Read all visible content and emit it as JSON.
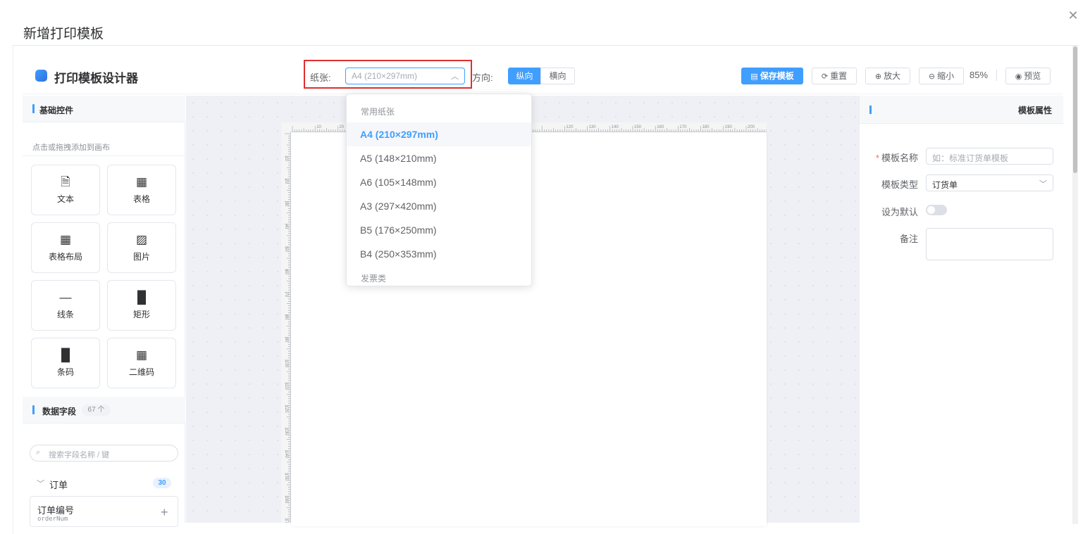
{
  "dialog": {
    "title": "新增打印模板",
    "close_icon": "close-icon"
  },
  "toolbar": {
    "designer_title": "打印模板设计器",
    "paper_label": "纸张:",
    "paper_value": "A4 (210×297mm)",
    "direction_label": "方向:",
    "portrait": "纵向",
    "landscape": "横向",
    "save": "保存模板",
    "reset": "重置",
    "zoom_in": "放大",
    "zoom_out": "缩小",
    "zoom": "85%",
    "preview": "预览"
  },
  "paper_dropdown": {
    "group_common": "常用纸张",
    "items": [
      "A4 (210×297mm)",
      "A5 (148×210mm)",
      "A6 (105×148mm)",
      "A3 (297×420mm)",
      "B5 (176×250mm)",
      "B4 (250×353mm)"
    ],
    "selected": "A4 (210×297mm)",
    "group_invoice": "发票类"
  },
  "left_panel": {
    "basic_title": "基础控件",
    "hint": "点击或拖拽添加到画布",
    "components": [
      {
        "label": "文本",
        "icon": "document-icon"
      },
      {
        "label": "表格",
        "icon": "grid-icon"
      },
      {
        "label": "表格布局",
        "icon": "grid-icon"
      },
      {
        "label": "图片",
        "icon": "image-icon"
      },
      {
        "label": "线条",
        "icon": "line-icon"
      },
      {
        "label": "矩形",
        "icon": "bar-chart-icon"
      },
      {
        "label": "条码",
        "icon": "bar-chart-icon"
      },
      {
        "label": "二维码",
        "icon": "grid-icon"
      }
    ],
    "fields_title": "数据字段",
    "fields_count": "67 个",
    "search_placeholder": "搜索字段名称 / 键",
    "group": {
      "title": "订单",
      "count": "30"
    },
    "field": {
      "name": "订单编号",
      "key": "orderNum"
    }
  },
  "ruler": {
    "top_ticks": [
      "10",
      "20",
      "120",
      "130",
      "140",
      "150",
      "160",
      "170",
      "180",
      "190",
      "200"
    ],
    "left_ticks": [
      "10",
      "20",
      "30",
      "40",
      "50",
      "60",
      "70",
      "80",
      "90",
      "100",
      "110",
      "120",
      "130",
      "140",
      "150",
      "160",
      "170"
    ]
  },
  "right_panel": {
    "title": "模板属性",
    "name_label": "模板名称",
    "name_placeholder": "如：标准订货单模板",
    "type_label": "模板类型",
    "type_value": "订货单",
    "default_label": "设为默认",
    "default_on": false,
    "remark_label": "备注"
  },
  "colors": {
    "primary": "#409eff",
    "highlight": "#e02e2e"
  }
}
